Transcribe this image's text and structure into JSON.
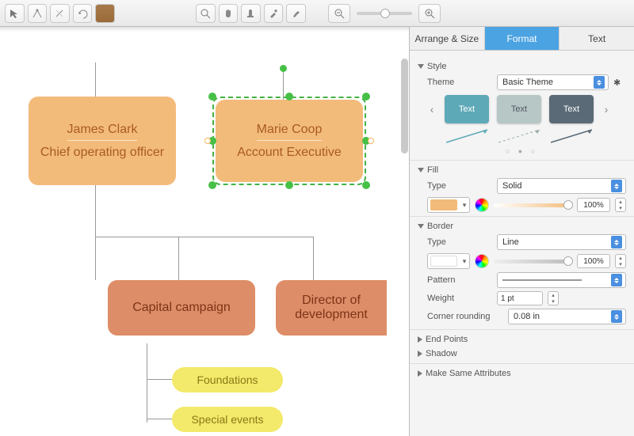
{
  "toolbar": {
    "icons": [
      "pointer",
      "anchor-edit",
      "shear",
      "rotate",
      "swatches",
      "zoom-tool",
      "hand-tool",
      "stamp",
      "eyedropper",
      "brush"
    ],
    "zoom": {
      "out": "−",
      "in": "+"
    }
  },
  "canvas": {
    "boxes": {
      "james": {
        "name": "James Clark",
        "role": "Chief operating officer"
      },
      "marie": {
        "name": "Marie Coop",
        "role": "Account Executive"
      },
      "capital": {
        "label": "Capital campaign"
      },
      "director": {
        "label": "Director of development"
      },
      "foundations": {
        "label": "Foundations"
      },
      "special": {
        "label": "Special events"
      }
    }
  },
  "inspector": {
    "tabs": {
      "arrange": "Arrange & Size",
      "format": "Format",
      "text": "Text"
    },
    "style": {
      "header": "Style",
      "theme_label": "Theme",
      "theme_value": "Basic Theme",
      "sample_text": "Text",
      "card_colors": [
        "#5ea9b8",
        "#b6c7c5",
        "#5a6a77"
      ]
    },
    "fill": {
      "header": "Fill",
      "type_label": "Type",
      "type_value": "Solid",
      "swatch": "#f3bb7a",
      "opacity": "100%"
    },
    "border": {
      "header": "Border",
      "type_label": "Type",
      "type_value": "Line",
      "swatch": "#ffffff",
      "opacity": "100%",
      "pattern_label": "Pattern",
      "weight_label": "Weight",
      "weight_value": "1 pt",
      "rounding_label": "Corner rounding",
      "rounding_value": "0.08 in"
    },
    "endpoints": {
      "header": "End Points"
    },
    "shadow": {
      "header": "Shadow"
    },
    "same": {
      "header": "Make Same Attributes"
    }
  }
}
